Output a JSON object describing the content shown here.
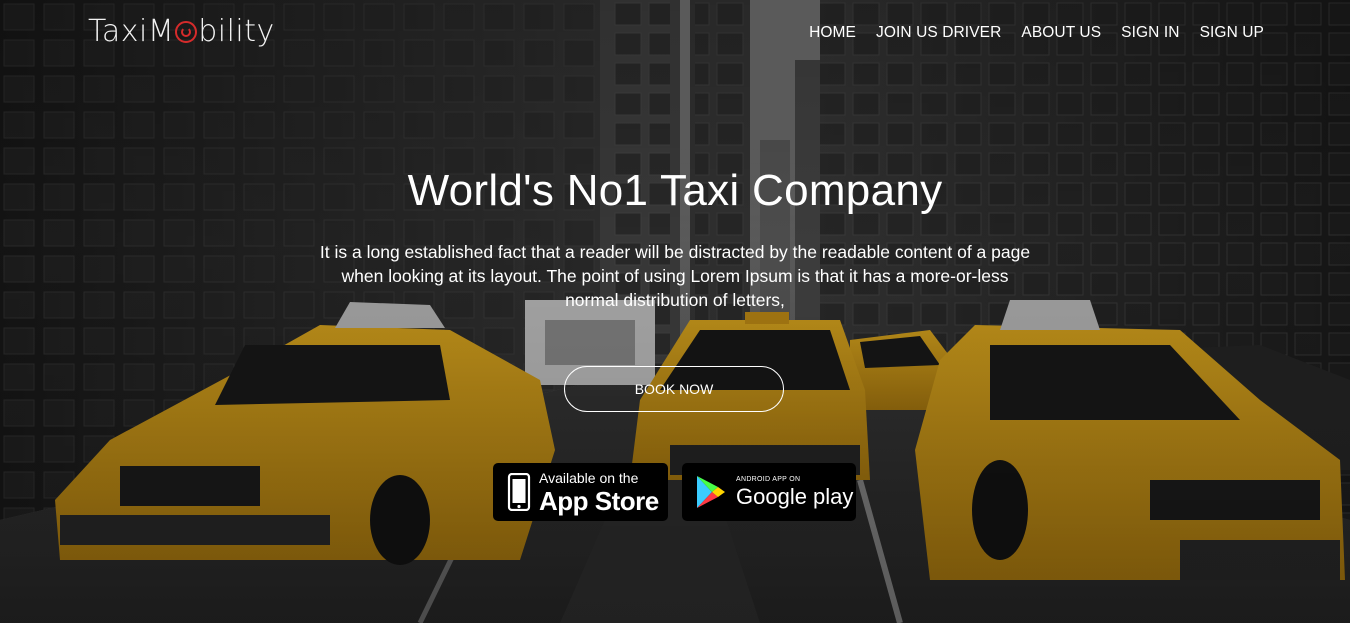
{
  "header": {
    "logo_text_before": "TaxiM",
    "logo_text_after": "bility",
    "nav": [
      {
        "label": "HOME"
      },
      {
        "label": "JOIN US DRIVER"
      },
      {
        "label": "ABOUT US"
      },
      {
        "label": "SIGN IN"
      },
      {
        "label": "SIGN UP"
      }
    ]
  },
  "hero": {
    "title": "World's No1 Taxi Company",
    "description": "It is a long established fact that a reader will be distracted by the readable content of a page when looking at its layout. The point of using Lorem Ipsum is that it has a more-or-less normal distribution of letters,",
    "book_button": "BOOK NOW",
    "app_store": {
      "small": "Available on the",
      "big": "App Store"
    },
    "google_play": {
      "small": "ANDROID APP ON",
      "big": "Google play"
    }
  },
  "colors": {
    "taxi_yellow": "#e8ad1a",
    "logo_accent": "#d62b2b"
  }
}
